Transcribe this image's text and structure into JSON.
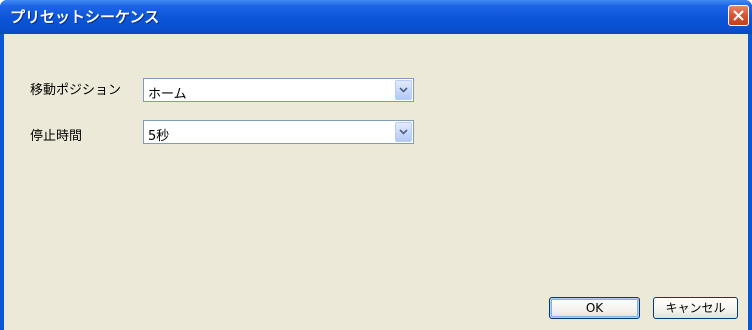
{
  "window": {
    "title": "プリセットシーケンス"
  },
  "titlebar": {
    "close_icon": "close-icon"
  },
  "form": {
    "position": {
      "label": "移動ポジション",
      "value": "ホーム"
    },
    "dwell": {
      "label": "停止時間",
      "value": "5秒"
    }
  },
  "buttons": {
    "ok": "OK",
    "cancel": "キャンセル"
  },
  "colors": {
    "titlebar": "#0b55d8",
    "client": "#ece9d8",
    "close": "#d8532f"
  }
}
